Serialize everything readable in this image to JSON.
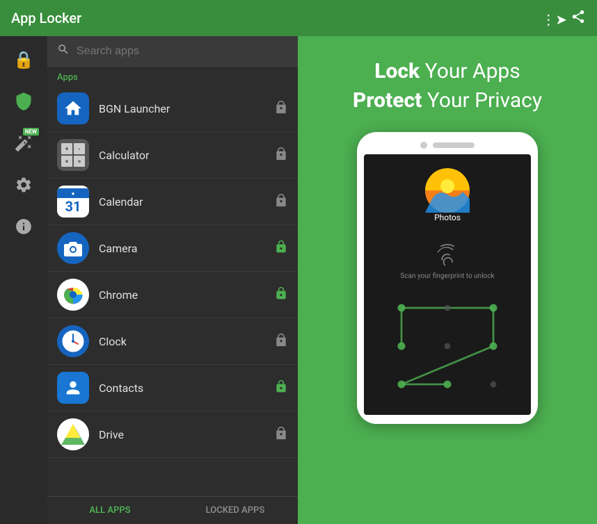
{
  "header": {
    "title": "App Locker",
    "share_label": "share"
  },
  "sidebar": {
    "icons": [
      "lock",
      "shield",
      "wand",
      "settings",
      "info"
    ]
  },
  "search": {
    "placeholder": "Search apps"
  },
  "apps_section_label": "Apps",
  "apps": [
    {
      "name": "BGN Launcher",
      "locked": false
    },
    {
      "name": "Calculator",
      "locked": false
    },
    {
      "name": "Calendar",
      "locked": false
    },
    {
      "name": "Camera",
      "locked": true
    },
    {
      "name": "Chrome",
      "locked": true
    },
    {
      "name": "Clock",
      "locked": false
    },
    {
      "name": "Contacts",
      "locked": true
    },
    {
      "name": "Drive",
      "locked": false
    }
  ],
  "tabs": {
    "all_apps": "ALL APPS",
    "locked_apps": "LOCKED APPS"
  },
  "promo": {
    "line1_bold": "Lock",
    "line1_rest": " Your Apps",
    "line2_bold": "Protect",
    "line2_rest": " Your Privacy"
  },
  "phone": {
    "app_label": "Photos",
    "fingerprint_text": "Scan your fingerprint to unlock"
  }
}
